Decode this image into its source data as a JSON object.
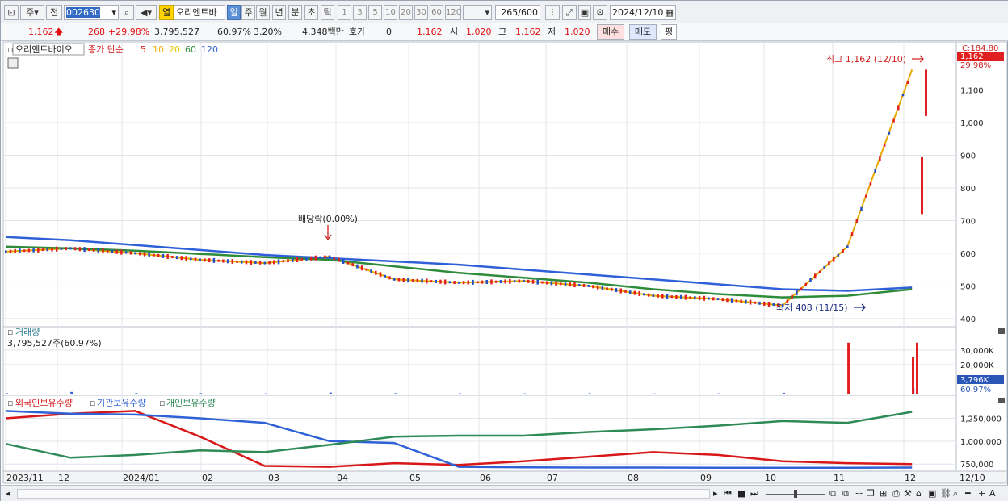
{
  "toolbar": {
    "market_label": "주",
    "prev_label": "전",
    "code_value": "002630",
    "stock_name": "오리엔트바",
    "yellow_label": "열",
    "periods": [
      "일",
      "주",
      "월",
      "년",
      "분",
      "초",
      "틱"
    ],
    "active_period": "일",
    "intervals": [
      "1",
      "3",
      "5",
      "10",
      "20",
      "30",
      "60",
      "120"
    ],
    "count_value": "265",
    "count_total": "/600",
    "date_value": "2024/12/10"
  },
  "quote": {
    "price": "1,162",
    "change": "268",
    "change_pct": "+29.98%",
    "volume": "3,795,527",
    "volume_ratio": "60.97%",
    "turnover": "3.20%",
    "amount": "4,348백만",
    "hoga_label": "호가",
    "hoga_value": "0",
    "hoga_price": "1,162",
    "open_label": "시",
    "open": "1,020",
    "high_label": "고",
    "high": "1,162",
    "low_label": "저",
    "low": "1,020",
    "buy_label": "매수",
    "sell_label": "매도",
    "eval_label": "평"
  },
  "price_panel": {
    "stock_label": "오리엔트바이오",
    "ma_label": "종가 단순",
    "ma_periods": [
      "5",
      "10",
      "20",
      "60",
      "120"
    ],
    "ma_colors": [
      "#e02020",
      "#f0b000",
      "#e8d800",
      "#2e8b3a",
      "#3060d8"
    ],
    "axis_top": "C:184.80",
    "price_tag": "1,162",
    "pct_tag": "29.98%",
    "high_annotation": "최고 1,162 (12/10)",
    "low_annotation": "최저 408 (11/15)",
    "dividend_annotation": "배당락(0.00%)"
  },
  "volume_panel": {
    "title": "거래량",
    "info": "3,795,527주(60.97%)",
    "tag": "3,796K",
    "pct_tag": "60.97%"
  },
  "holding_panel": {
    "legend": [
      "외국인보유수량",
      "기관보유수량",
      "개인보유수량"
    ],
    "colors": [
      "#d81818",
      "#2f62d6",
      "#2e8b57"
    ]
  },
  "x_axis": {
    "labels": [
      "2023/11",
      "12",
      "2024/01",
      "02",
      "03",
      "04",
      "05",
      "06",
      "07",
      "08",
      "09",
      "10",
      "11",
      "12"
    ],
    "end_label": "12/10"
  },
  "chart_data": [
    {
      "type": "line",
      "title": "오리엔트바이오 종가 단순 5 10 20 60 120",
      "x": [
        "2023/11",
        "12",
        "2024/01",
        "02",
        "03",
        "04",
        "05",
        "06",
        "07",
        "08",
        "09",
        "10",
        "11",
        "12",
        "12/10"
      ],
      "series": [
        {
          "name": "종가",
          "values": [
            605,
            615,
            600,
            580,
            570,
            590,
            520,
            510,
            515,
            500,
            470,
            460,
            440,
            620,
            1162
          ]
        },
        {
          "name": "120",
          "values": [
            650,
            640,
            625,
            610,
            595,
            585,
            575,
            565,
            550,
            535,
            520,
            505,
            490,
            485,
            495
          ]
        },
        {
          "name": "60",
          "values": [
            620,
            615,
            608,
            598,
            588,
            580,
            560,
            540,
            525,
            510,
            490,
            475,
            465,
            470,
            490
          ]
        }
      ],
      "ylim": [
        380,
        1200
      ],
      "y_ticks": [
        400,
        500,
        600,
        700,
        800,
        900,
        1000,
        1100
      ]
    },
    {
      "type": "bar",
      "title": "거래량",
      "y_ticks": [
        "20,000K",
        "30,000K"
      ],
      "values_k": [
        300,
        1200,
        400,
        300,
        200,
        800,
        300,
        250,
        200,
        300,
        150,
        200,
        600,
        35000,
        3796
      ]
    },
    {
      "type": "line",
      "title": "보유수량",
      "y_ticks": [
        "750,000",
        "1,000,000",
        "1,250,000"
      ],
      "series": [
        {
          "name": "외국인보유수량",
          "values": [
            1250000,
            1300000,
            1330000,
            1050000,
            730000,
            720000,
            760000,
            740000,
            780000,
            830000,
            880000,
            850000,
            780000,
            760000,
            750000
          ]
        },
        {
          "name": "기관보유수량",
          "values": [
            1330000,
            1300000,
            1290000,
            1250000,
            1200000,
            1000000,
            980000,
            720000,
            715000,
            712000,
            712000,
            710000,
            710000,
            710000,
            712000
          ]
        },
        {
          "name": "개인보유수량",
          "values": [
            970000,
            820000,
            850000,
            900000,
            880000,
            960000,
            1050000,
            1060000,
            1060000,
            1100000,
            1130000,
            1170000,
            1220000,
            1200000,
            1320000
          ]
        }
      ]
    }
  ]
}
